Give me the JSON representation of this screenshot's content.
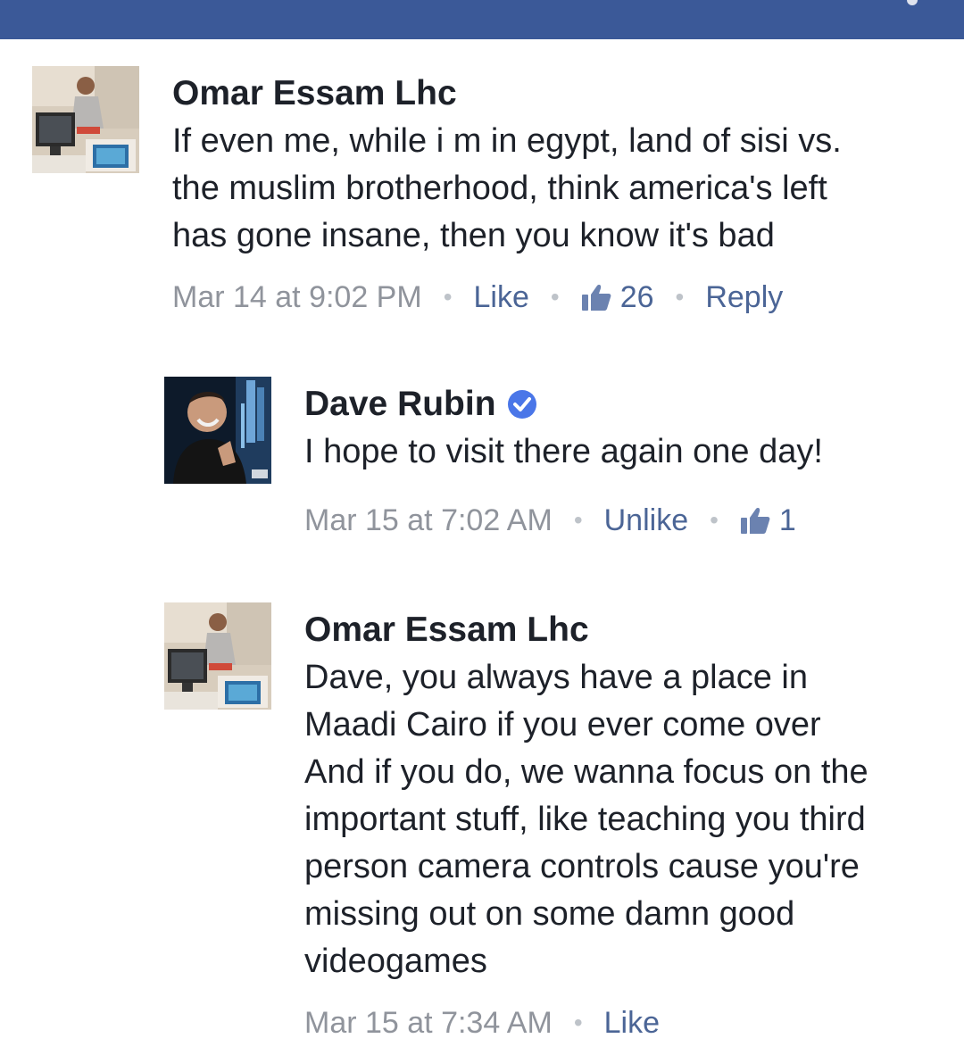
{
  "comments": [
    {
      "author": "Omar Essam Lhc",
      "lines": [
        "If even me, while i m in egypt, land of sisi vs.",
        "the muslim brotherhood, think america's left",
        "has gone insane, then you know it's bad"
      ],
      "timestamp": "Mar 14 at 9:02 PM",
      "like_label": "Like",
      "likes": "26",
      "reply_label": "Reply"
    },
    {
      "author": "Dave Rubin",
      "verified": true,
      "lines": [
        "I hope to visit there again one day!"
      ],
      "timestamp": "Mar 15 at 7:02 AM",
      "like_label": "Unlike",
      "likes": "1"
    },
    {
      "author": "Omar Essam Lhc",
      "lines": [
        "Dave, you always have a place in",
        "Maadi Cairo if you ever come over",
        "And if you do, we wanna focus on the",
        "important stuff, like teaching you third",
        "person camera controls cause you're",
        "missing out on some damn good",
        "videogames"
      ],
      "timestamp": "Mar 15 at 7:34 AM",
      "like_label": "Like"
    }
  ],
  "colors": {
    "topbar": "#3b5998",
    "link": "#4b6596",
    "meta": "#90949c",
    "verified": "#4a76e8"
  },
  "icons": {
    "like_count": "thumbs-up-icon",
    "verified": "verified-badge-icon"
  }
}
